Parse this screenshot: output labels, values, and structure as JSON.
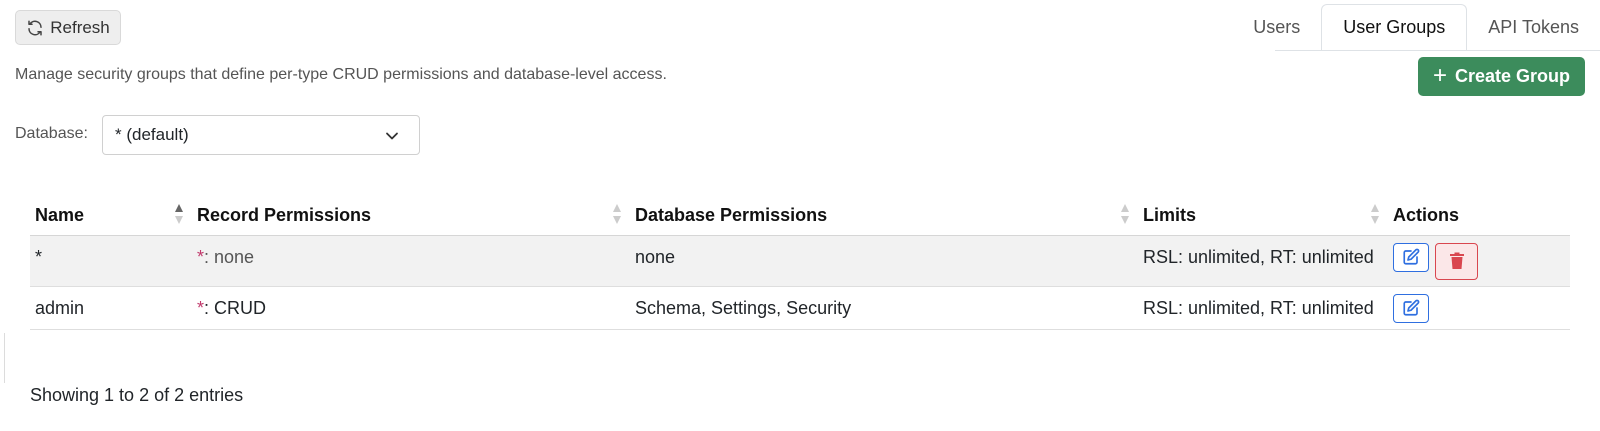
{
  "toolbar": {
    "refresh_label": "Refresh"
  },
  "tabs": [
    {
      "label": "Users",
      "active": false
    },
    {
      "label": "User Groups",
      "active": true
    },
    {
      "label": "API Tokens",
      "active": false
    }
  ],
  "description": "Manage security groups that define per-type CRUD permissions and database-level access.",
  "create_button": {
    "label": "Create Group"
  },
  "database_filter": {
    "label": "Database:",
    "selected": "* (default)"
  },
  "table": {
    "columns": [
      "Name",
      "Record Permissions",
      "Database Permissions",
      "Limits",
      "Actions"
    ],
    "rows": [
      {
        "name": "*",
        "record_star": "*",
        "record_perm": ": none",
        "db_perm": "none",
        "limits": "RSL: unlimited, RT: unlimited",
        "can_delete": true
      },
      {
        "name": "admin",
        "record_star": "*",
        "record_perm": ": CRUD",
        "db_perm": "Schema, Settings, Security",
        "limits": "RSL: unlimited, RT: unlimited",
        "can_delete": false
      }
    ]
  },
  "footer": {
    "info": "Showing 1 to 2 of 2 entries"
  },
  "colors": {
    "primary_green": "#3c8c5c",
    "edit_blue": "#2f6fe0",
    "delete_red": "#d9464f",
    "star_pink": "#c0396b"
  },
  "icons": {
    "refresh": "refresh-icon",
    "plus": "plus-icon",
    "chevron": "chevron-down-icon",
    "edit": "edit-icon",
    "delete": "trash-icon",
    "sort": "sort-icon"
  }
}
